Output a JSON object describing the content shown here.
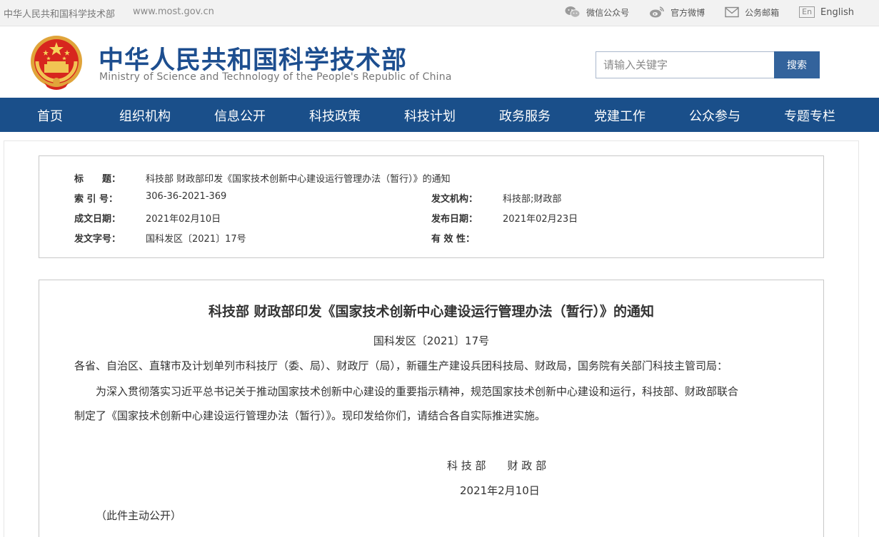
{
  "topbar": {
    "site_name": "中华人民共和国科学技术部",
    "site_url": "www.most.gov.cn",
    "links": {
      "wechat": "微信公众号",
      "weibo": "官方微博",
      "mail": "公务邮箱",
      "en_badge": "En",
      "english": "English"
    }
  },
  "header": {
    "title_cn": "中华人民共和国科学技术部",
    "title_en": "Ministry of Science and Technology of the People's Republic of China",
    "search_placeholder": "请输入关键字",
    "search_button": "搜索"
  },
  "nav": {
    "items": [
      "首页",
      "组织机构",
      "信息公开",
      "科技政策",
      "科技计划",
      "政务服务",
      "党建工作",
      "公众参与",
      "专题专栏"
    ]
  },
  "meta": {
    "title_label": "标　　题：",
    "title_value": "科技部 财政部印发《国家技术创新中心建设运行管理办法（暂行）》的通知",
    "index_label": "索 引 号：",
    "index_value": "306-36-2021-369",
    "issuer_label": "发文机构：",
    "issuer_value": "科技部;财政部",
    "created_label": "成文日期：",
    "created_value": "2021年02月10日",
    "published_label": "发布日期：",
    "published_value": "2021年02月23日",
    "docno_label": "发文字号：",
    "docno_value": "国科发区〔2021〕17号",
    "validity_label": "有 效 性："
  },
  "article": {
    "title": "科技部 财政部印发《国家技术创新中心建设运行管理办法（暂行）》的通知",
    "doc_number": "国科发区〔2021〕17号",
    "salutation": "各省、自治区、直辖市及计划单列市科技厅（委、局）、财政厅（局），新疆生产建设兵团科技局、财政局，国务院有关部门科技主管司局：",
    "body_line1": "为深入贯彻落实习近平总书记关于推动国家技术创新中心建设的重要指示精神，规范国家技术创新中心建设和运行，科技部、财政部联合",
    "body_line2": "制定了《国家技术创新中心建设运行管理办法（暂行）》。现印发给你们，请结合各自实际推进实施。",
    "signatories": "科 技 部　　财 政 部",
    "sign_date": "2021年2月10日",
    "note": "（此件主动公开）"
  },
  "colors": {
    "brand_blue": "#1d4e8f",
    "nav_blue": "#1a4f8a",
    "button_blue": "#33639c"
  }
}
